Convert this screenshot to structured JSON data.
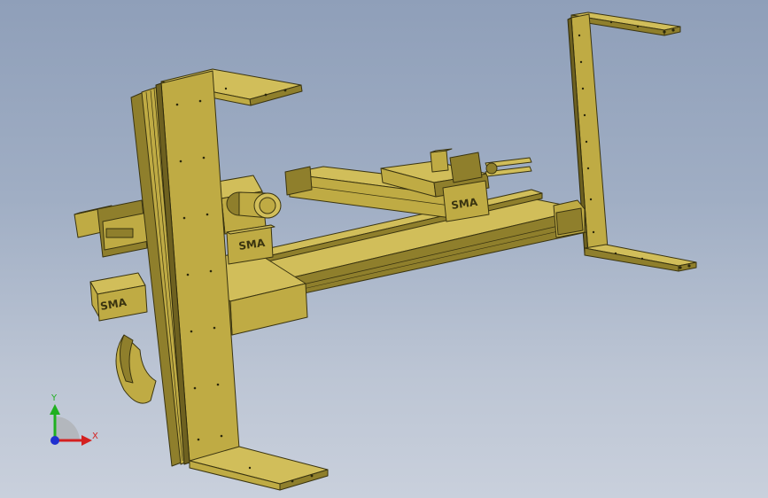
{
  "viewport": {
    "background_top": "#8f9fb9",
    "background_bottom": "#c9d0dc"
  },
  "model": {
    "part_color": "#bfab44",
    "part_shadow_color": "#8f7f2c",
    "edge_color": "#3a3410",
    "logos": [
      "SMA",
      "SMA",
      "SMA"
    ]
  },
  "triad": {
    "x_label": "X",
    "y_label": "Y",
    "x_color": "#d42020",
    "y_color": "#20b020",
    "z_color": "#2030d0"
  }
}
